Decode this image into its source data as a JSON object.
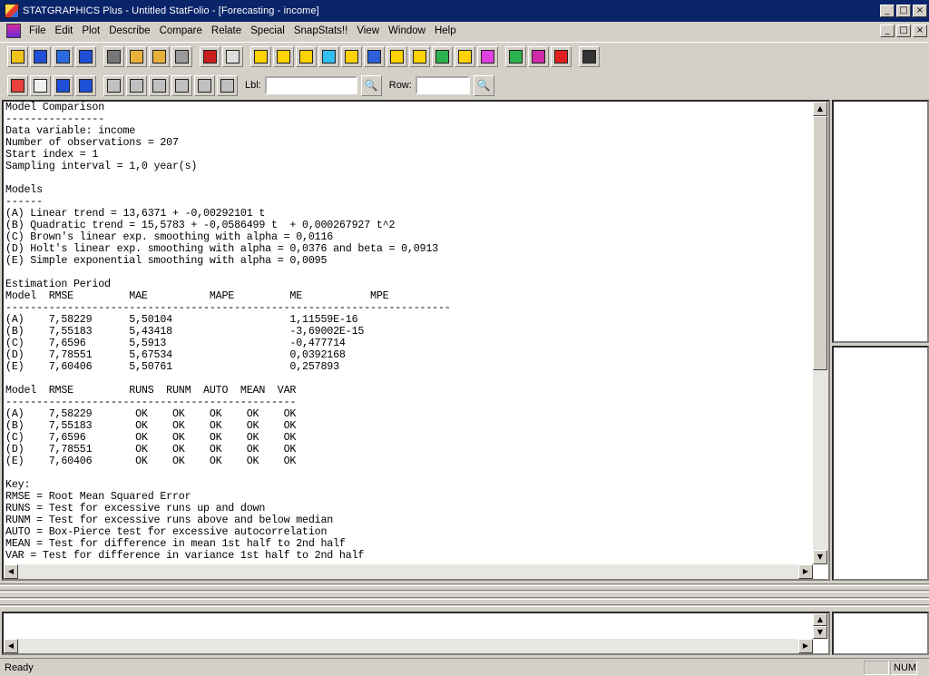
{
  "window": {
    "title": "STATGRAPHICS Plus - Untitled StatFolio - [Forecasting - income]",
    "minimize": "_",
    "maximize": "□",
    "close": "×"
  },
  "menu": {
    "items": [
      "File",
      "Edit",
      "Plot",
      "Describe",
      "Compare",
      "Relate",
      "Special",
      "SnapStats!!",
      "View",
      "Window",
      "Help"
    ]
  },
  "toolbar1": {
    "buttons": [
      {
        "icon": "open-folder-icon",
        "color": "#f0c419"
      },
      {
        "icon": "save-icon",
        "color": "#1f4fd6"
      },
      {
        "icon": "spreadsheet-icon",
        "color": "#2a6be0"
      },
      {
        "icon": "data-save-icon",
        "color": "#1f4fd6"
      },
      {
        "icon": "cut-icon",
        "color": "#777777"
      },
      {
        "icon": "copy-icon",
        "color": "#e8b23a"
      },
      {
        "icon": "paste-icon",
        "color": "#e8b23a"
      },
      {
        "icon": "undo-icon",
        "color": "#9a9a9a"
      },
      {
        "icon": "print-icon",
        "color": "#c81e1e"
      },
      {
        "icon": "print-preview-icon",
        "color": "#dddddd"
      },
      {
        "icon": "scatter-plot-icon",
        "color": "#ffd200"
      },
      {
        "icon": "box-plot-icon",
        "color": "#ffd200"
      },
      {
        "icon": "histogram-icon",
        "color": "#ffd200"
      },
      {
        "icon": "xy-plot-icon",
        "color": "#30c0f0"
      },
      {
        "icon": "grid-plot-icon",
        "color": "#ffd200"
      },
      {
        "icon": "wave-plot-icon",
        "color": "#2c5fd8"
      },
      {
        "icon": "bell-curve-icon",
        "color": "#ffd200"
      },
      {
        "icon": "line-chart-icon",
        "color": "#ffd200"
      },
      {
        "icon": "globe-icon",
        "color": "#2bb24c"
      },
      {
        "icon": "step-chart-icon",
        "color": "#ffd200"
      },
      {
        "icon": "gem-icon",
        "color": "#e040e0"
      },
      {
        "icon": "go-arrow-icon",
        "color": "#2bb24c"
      },
      {
        "icon": "sigma-icon",
        "color": "#d02aa8"
      },
      {
        "icon": "help-icon",
        "color": "#e02020"
      },
      {
        "icon": "calculator-icon",
        "color": "#333333"
      }
    ]
  },
  "toolbar2": {
    "buttons": [
      {
        "icon": "analysis-icon",
        "color": "#e8403a"
      },
      {
        "icon": "text-pane-icon",
        "color": "#f0f0f0"
      },
      {
        "icon": "graph-pane-icon",
        "color": "#1f4fd6"
      },
      {
        "icon": "graph-save-icon",
        "color": "#1f4fd6"
      },
      {
        "icon": "label-icon",
        "color": "#c0c0c0"
      },
      {
        "icon": "move-icon",
        "color": "#c0c0c0"
      },
      {
        "icon": "brush-icon",
        "color": "#c0c0c0"
      },
      {
        "icon": "jitter-icon",
        "color": "#c0c0c0"
      },
      {
        "icon": "zoom-icon",
        "color": "#c0c0c0"
      },
      {
        "icon": "smooth-icon",
        "color": "#c0c0c0"
      }
    ],
    "lbl_label": "Lbl:",
    "lbl_value": "",
    "row_label": "Row:",
    "row_value": ""
  },
  "document": {
    "lines": [
      "Model Comparison",
      "----------------",
      "Data variable: income",
      "Number of observations = 207",
      "Start index = 1",
      "Sampling interval = 1,0 year(s)",
      "",
      "Models",
      "------",
      "(A) Linear trend = 13,6371 + -0,00292101 t",
      "(B) Quadratic trend = 15,5783 + -0,0586499 t  + 0,000267927 t^2",
      "(C) Brown's linear exp. smoothing with alpha = 0,0116",
      "(D) Holt's linear exp. smoothing with alpha = 0,0376 and beta = 0,0913",
      "(E) Simple exponential smoothing with alpha = 0,0095",
      "",
      "Estimation Period",
      "Model  RMSE         MAE          MAPE         ME           MPE",
      "------------------------------------------------------------------------",
      "(A)    7,58229      5,50104                   1,11559E-16",
      "(B)    7,55183      5,43418                   -3,69002E-15",
      "(C)    7,6596       5,5913                    -0,477714",
      "(D)    7,78551      5,67534                   0,0392168",
      "(E)    7,60406      5,50761                   0,257893",
      "",
      "Model  RMSE         RUNS  RUNM  AUTO  MEAN  VAR",
      "-----------------------------------------------",
      "(A)    7,58229       OK    OK    OK    OK    OK",
      "(B)    7,55183       OK    OK    OK    OK    OK",
      "(C)    7,6596        OK    OK    OK    OK    OK",
      "(D)    7,78551       OK    OK    OK    OK    OK",
      "(E)    7,60406       OK    OK    OK    OK    OK",
      "",
      "Key:",
      "RMSE = Root Mean Squared Error",
      "RUNS = Test for excessive runs up and down",
      "RUNM = Test for excessive runs above and below median",
      "AUTO = Box-Pierce test for excessive autocorrelation",
      "MEAN = Test for difference in mean 1st half to 2nd half",
      "VAR = Test for difference in variance 1st half to 2nd half"
    ]
  },
  "scroll": {
    "up": "▲",
    "down": "▼",
    "left": "◀",
    "right": "▶"
  },
  "status": {
    "text": "Ready",
    "num": "NUM"
  }
}
